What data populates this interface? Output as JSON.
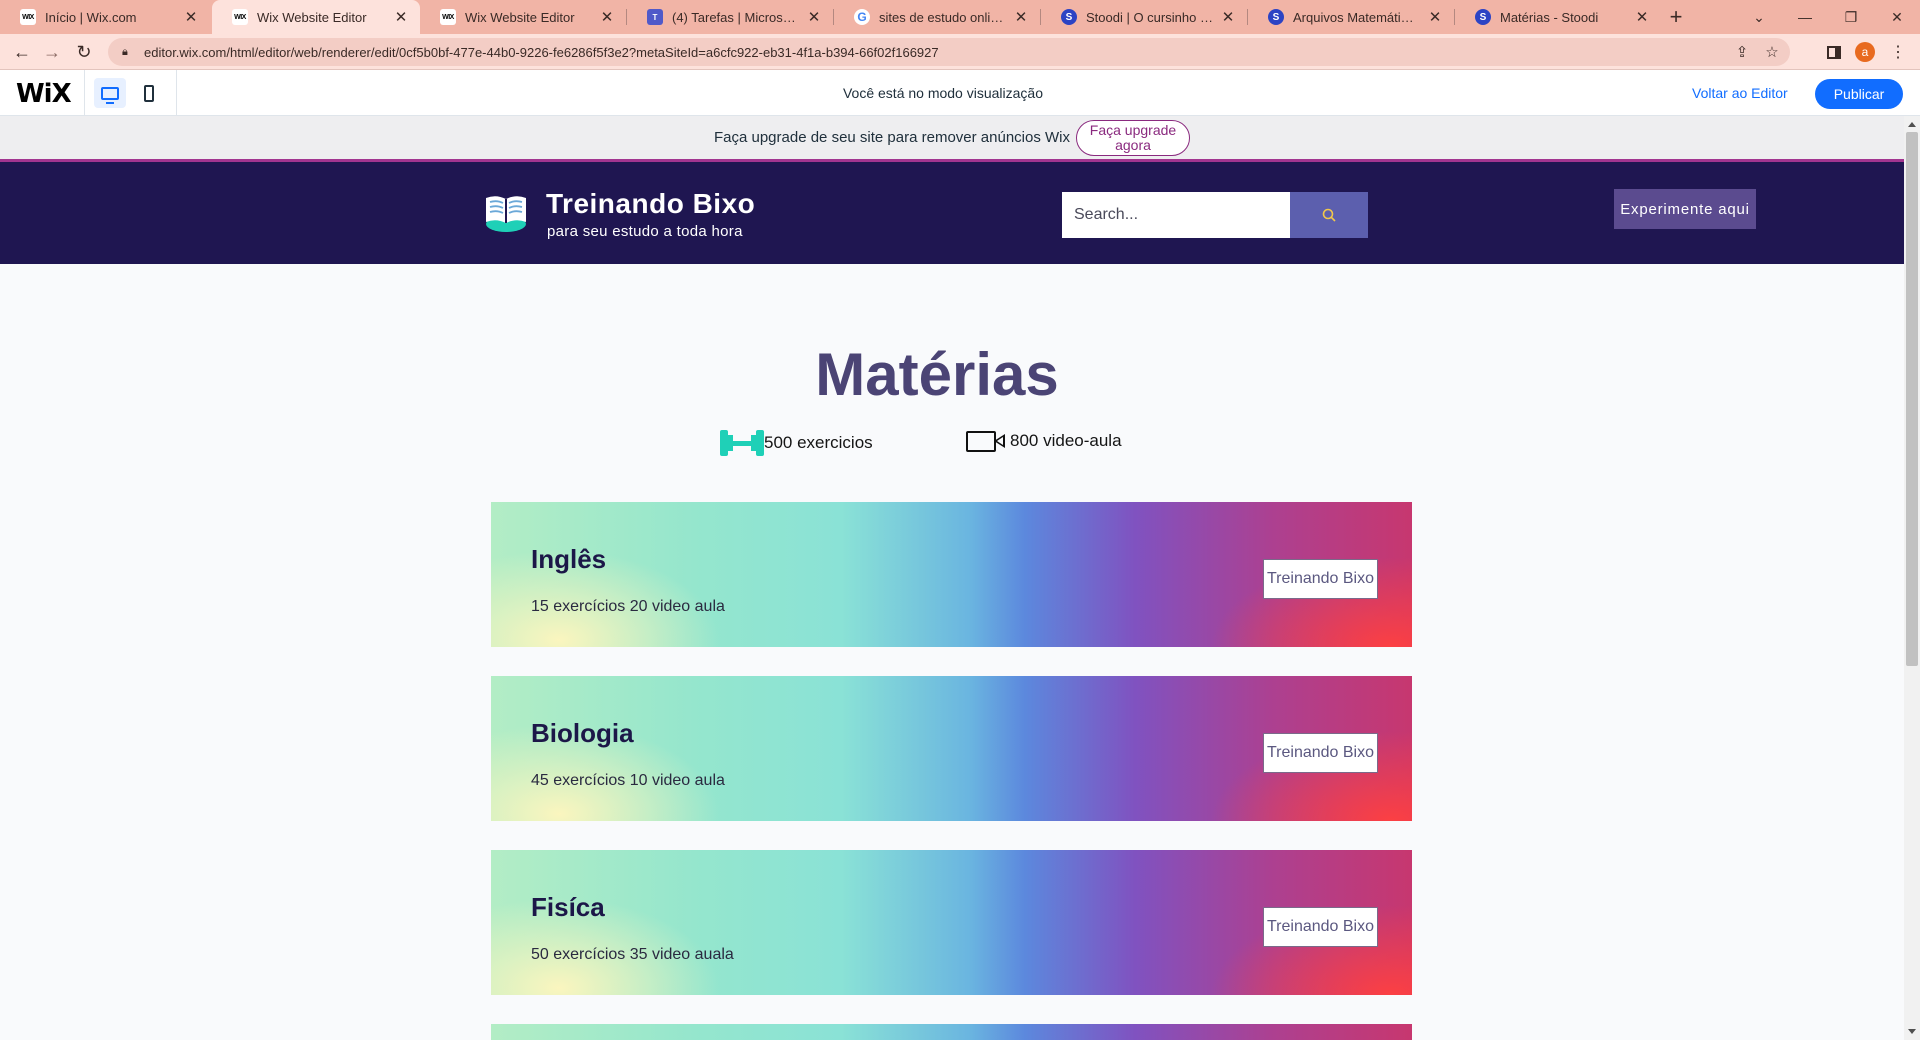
{
  "browser": {
    "tabs": [
      {
        "label": "Início | Wix.com",
        "icon": "wix-favicon"
      },
      {
        "label": "Wix Website Editor",
        "icon": "wix-favicon",
        "active": true
      },
      {
        "label": "Wix Website Editor",
        "icon": "wix-favicon"
      },
      {
        "label": "(4) Tarefas | Microsoft Teams",
        "icon": "teams-favicon"
      },
      {
        "label": "sites de estudo online - Pesquisa Google",
        "icon": "google-favicon"
      },
      {
        "label": "Stoodi | O cursinho online",
        "icon": "stoodi-favicon"
      },
      {
        "label": "Arquivos Matemática - Blog do Stoodi",
        "icon": "stoodi-favicon"
      },
      {
        "label": "Matérias - Stoodi",
        "icon": "stoodi-favicon"
      }
    ],
    "url": "editor.wix.com/html/editor/web/renderer/edit/0cf5b0bf-477e-44b0-9226-fe6286f5f3e2?metaSiteId=a6cfc922-eb31-4f1a-b394-66f02f166927",
    "profile_initial": "a"
  },
  "wix_bar": {
    "logo": "WiX",
    "mode_text": "Você está no modo visualização",
    "back_to_editor": "Voltar ao Editor",
    "publish": "Publicar"
  },
  "upgrade_banner": {
    "text": "Faça upgrade de seu site para remover anúncios Wix",
    "button": "Faça upgrade agora"
  },
  "site_header": {
    "title": "Treinando Bixo",
    "tagline": "para seu estudo a toda hora",
    "search_placeholder": "Search...",
    "cta": "Experimente aqui"
  },
  "page": {
    "title": "Matérias",
    "stats": {
      "exercises": "500 exercicios",
      "videos": "800 video-aula"
    },
    "subjects": [
      {
        "name": "Inglês",
        "info": "15 exercícios 20 video aula",
        "button": "Treinando Bixo"
      },
      {
        "name": "Biologia",
        "info": "45 exercícios 10 video aula",
        "button": "Treinando Bixo"
      },
      {
        "name": "Fisíca",
        "info": "50 exercícios 35 video auala",
        "button": "Treinando Bixo"
      },
      {
        "name": "",
        "info": "",
        "button": ""
      }
    ]
  },
  "colors": {
    "tab_strip": "#f1b4a6",
    "site_header_bg": "#1f1651",
    "title_color": "#4b4475",
    "wix_blue": "#116dff",
    "upgrade_purple": "#8a2a7f"
  }
}
